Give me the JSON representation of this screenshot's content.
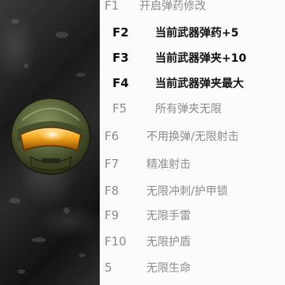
{
  "hotkeys": [
    {
      "key": "F1",
      "label": "开启弹药修改",
      "active": false
    },
    {
      "key": "F2",
      "label": "当前武器弹药+5",
      "active": true
    },
    {
      "key": "F3",
      "label": "当前武器弹夹+10",
      "active": true
    },
    {
      "key": "F4",
      "label": "当前武器弹夹最大",
      "active": true
    },
    {
      "key": "F5",
      "label": "所有弹夹无限",
      "active": false
    },
    {
      "key": "F6",
      "label": "不用换弹/无限射击",
      "active": false
    },
    {
      "key": "F7",
      "label": "精准射击",
      "active": false
    },
    {
      "key": "F8",
      "label": "无限冲刺/护甲锁",
      "active": false
    },
    {
      "key": "F9",
      "label": "无限手雷",
      "active": false
    },
    {
      "key": "F10",
      "label": "无限护盾",
      "active": false
    },
    {
      "key": "5",
      "label": "无限生命",
      "active": false
    }
  ],
  "colors": {
    "active_text": "#111111",
    "inactive_text": "#8c8c8c",
    "helmet_visor": "#f2a51a"
  },
  "art": {
    "icon": "armored-helmet-icon"
  }
}
